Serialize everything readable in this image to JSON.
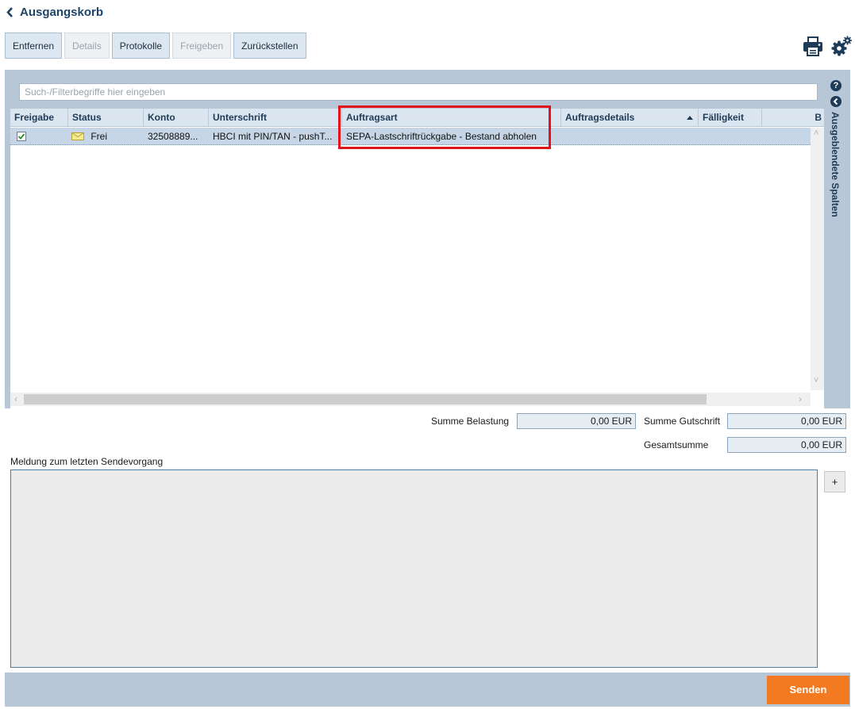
{
  "header": {
    "title": "Ausgangskorb"
  },
  "toolbar": {
    "buttons": [
      {
        "label": "Entfernen",
        "enabled": true
      },
      {
        "label": "Details",
        "enabled": false
      },
      {
        "label": "Protokolle",
        "enabled": true
      },
      {
        "label": "Freigeben",
        "enabled": false
      },
      {
        "label": "Zurückstellen",
        "enabled": true
      }
    ]
  },
  "icons": {
    "print": "printer-icon",
    "settings": "gears-icon",
    "help": "help-icon",
    "collapse": "chevron-left-icon"
  },
  "search": {
    "placeholder": "Such-/Filterbegriffe hier eingeben",
    "value": ""
  },
  "grid": {
    "columns": [
      "Freigabe",
      "Status",
      "Konto",
      "Unterschrift",
      "Auftragsart",
      "Auftragsdetails",
      "Fälligkeit",
      "B"
    ],
    "sort": {
      "column": "Auftragsdetails",
      "direction": "ascending"
    },
    "rows": [
      {
        "freigabe": true,
        "status": "Frei",
        "konto": "32508889...",
        "unterschrift": "HBCI mit PIN/TAN - pushT...",
        "auftragsart": "SEPA-Lastschriftrückgabe - Bestand abholen",
        "auftragsdetails": "",
        "faelligkeit": ""
      }
    ],
    "hidden_columns_label": "Ausgeblendete Spalten"
  },
  "sums": {
    "belastung_label": "Summe Belastung",
    "belastung_value": "0,00 EUR",
    "gutschrift_label": "Summe Gutschrift",
    "gutschrift_value": "0,00 EUR",
    "gesamt_label": "Gesamtsumme",
    "gesamt_value": "0,00 EUR"
  },
  "message": {
    "label": "Meldung zum letzten Sendevorgang",
    "expand_label": "+"
  },
  "footer": {
    "send_label": "Senden"
  },
  "colors": {
    "accent": "#f37a21",
    "highlight": "#e0151b",
    "panel": "#b8c7d8",
    "header_text": "#1d4468"
  }
}
